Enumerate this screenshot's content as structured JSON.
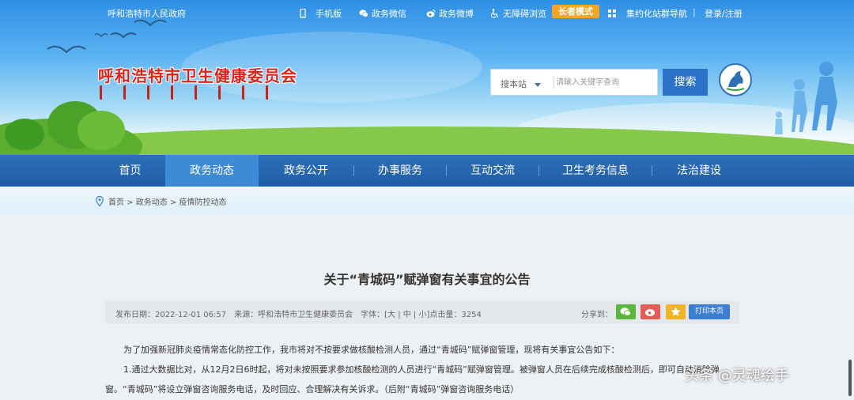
{
  "top_bar": {
    "gov_link": "呼和浩特市人民政府",
    "mobile": "手机版",
    "wechat": "政务微信",
    "weibo": "政务微博",
    "accessibility": "无障碍浏览",
    "elder_mode": "长者模式",
    "site_nav": "集约化站群导航",
    "login": "登录/注册",
    "separator": "|"
  },
  "header": {
    "site_title": "呼和浩特市卫生健康委员会",
    "search_scope": "搜本站",
    "search_placeholder": "请输入关键字查询",
    "search_button": "搜索"
  },
  "nav": {
    "items": [
      "首页",
      "政务动态",
      "政务公开",
      "办事服务",
      "互动交流",
      "卫生考务信息",
      "法治建设"
    ],
    "active_index": 1
  },
  "breadcrumb": "首页 > 政务动态 > 疫情防控动态",
  "article": {
    "title": "关于“青城码”赋弹窗有关事宜的公告",
    "meta": "发布日期：2022-12-01 06:57　来源：呼和浩特市卫生健康委员会　字体：[大 | 中 | 小]点击量：3254",
    "share_label": "分享到：",
    "print_button": "打印本页",
    "paragraphs": [
      "为了加强新冠肺炎疫情常态化防控工作，我市将对不按要求做核酸检测人员，通过“青城码”赋弹窗管理，现将有关事宜公告如下：",
      "1.通过大数据比对，从12月2日6时起，将对未按照要求参加核酸检测的人员进行“青城码”赋弹窗管理。被弹窗人员在后续完成核酸检测后，即可自动消除弹",
      "窗。“青城码”将设立弹窗咨询服务电话，及时回应、合理解决有关诉求。（后附“青城码”弹窗咨询服务电话）"
    ]
  },
  "watermark": "头条 @灵魂绘手",
  "colors": {
    "nav_bg": "#1f5ea7",
    "nav_active": "#3d8bd6",
    "title_red": "#d9261c",
    "elder_orange": "#f5a623",
    "search_blue": "#2c72c8"
  }
}
